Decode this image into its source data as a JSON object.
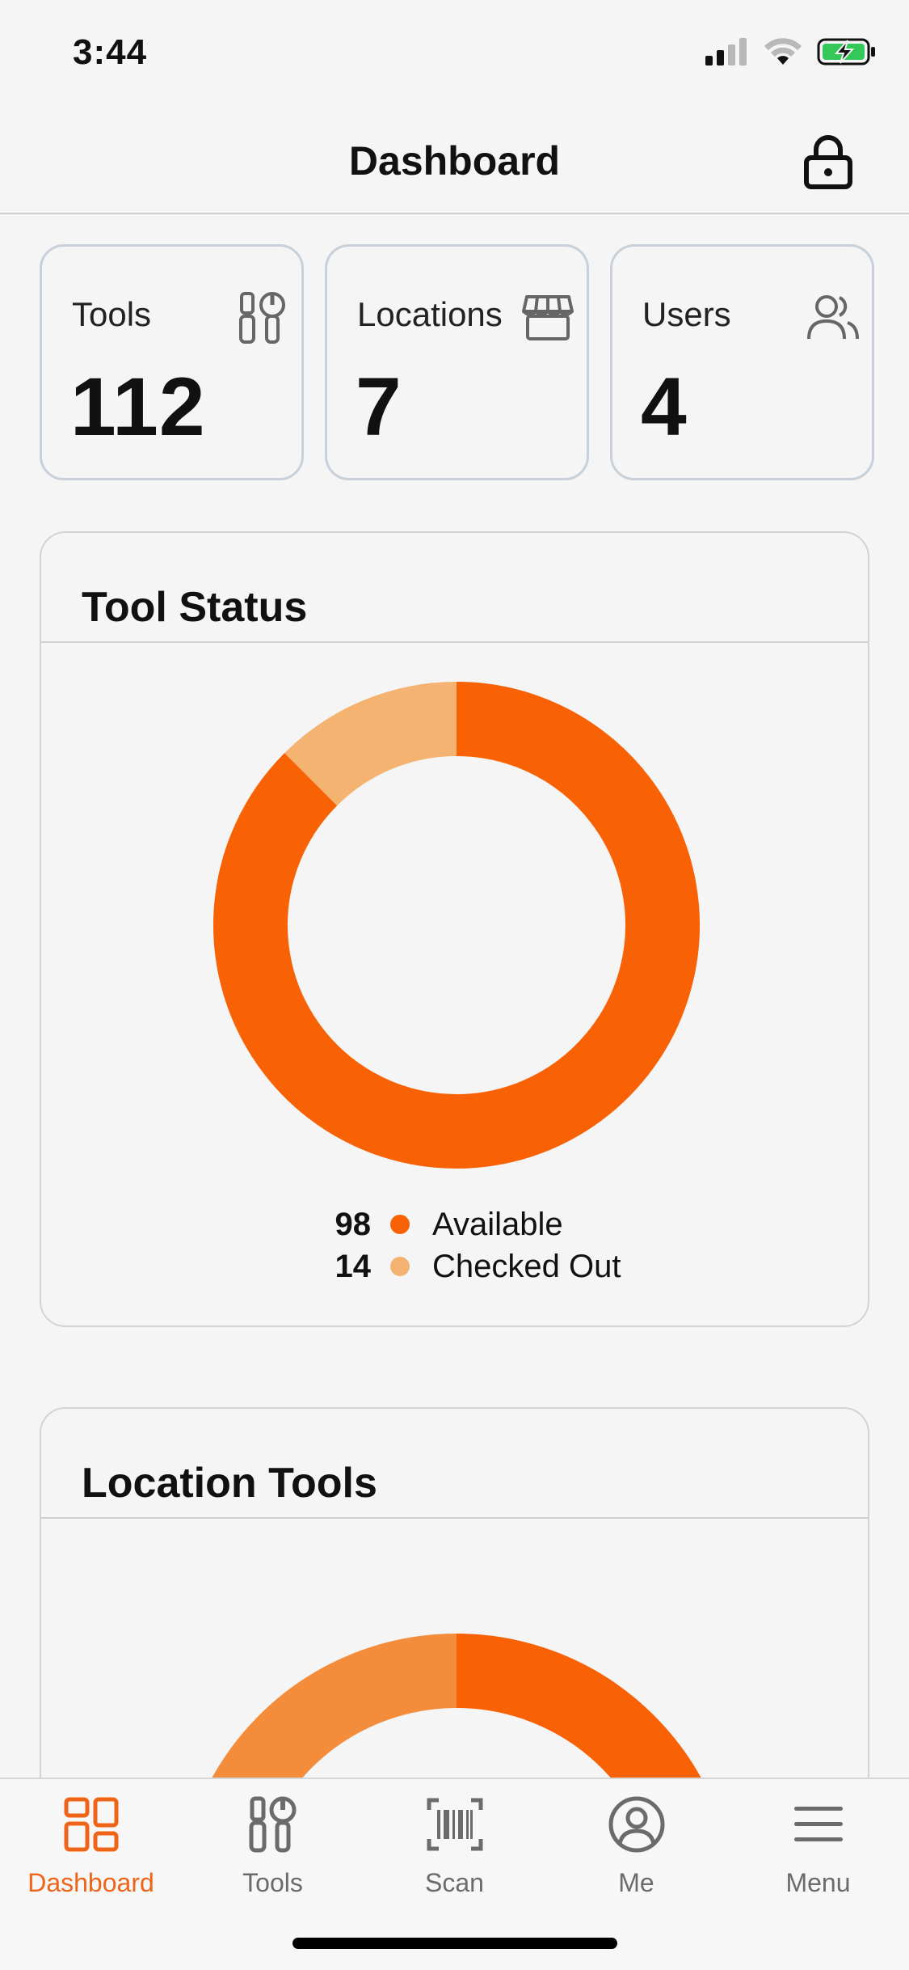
{
  "status_bar": {
    "time": "3:44"
  },
  "header": {
    "title": "Dashboard"
  },
  "stats": [
    {
      "label": "Tools",
      "value": "112",
      "icon": "tools-icon"
    },
    {
      "label": "Locations",
      "value": "7",
      "icon": "storefront-icon"
    },
    {
      "label": "Users",
      "value": "4",
      "icon": "users-icon"
    }
  ],
  "tool_status": {
    "title": "Tool Status",
    "chart_data": {
      "type": "pie",
      "donut": true,
      "categories": [
        "Available",
        "Checked Out"
      ],
      "values": [
        98,
        14
      ],
      "colors": [
        "#f86205",
        "#f5b372"
      ]
    },
    "legend": [
      {
        "count": "98",
        "label": "Available",
        "color": "#f86205"
      },
      {
        "count": "14",
        "label": "Checked Out",
        "color": "#f5b372"
      }
    ]
  },
  "location_tools": {
    "title": "Location Tools",
    "visible_colors": [
      "#f86205",
      "#f38c3b"
    ]
  },
  "tab_bar": {
    "tabs": [
      {
        "label": "Dashboard",
        "icon": "dashboard-icon",
        "active": true
      },
      {
        "label": "Tools",
        "icon": "tools-icon",
        "active": false
      },
      {
        "label": "Scan",
        "icon": "barcode-scan-icon",
        "active": false
      },
      {
        "label": "Me",
        "icon": "user-circle-icon",
        "active": false
      },
      {
        "label": "Menu",
        "icon": "hamburger-menu-icon",
        "active": false
      }
    ]
  },
  "colors": {
    "accent": "#f06418",
    "inactive": "#6b6b6b"
  }
}
